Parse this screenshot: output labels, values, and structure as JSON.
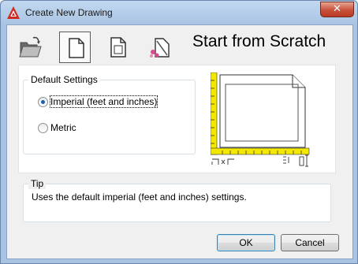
{
  "window": {
    "title": "Create New Drawing",
    "close_glyph": "✕"
  },
  "toolbar": {
    "items": [
      {
        "name": "open-drawing",
        "icon": "folder-open-icon",
        "selected": false
      },
      {
        "name": "start-from-scratch",
        "icon": "blank-page-icon",
        "selected": true
      },
      {
        "name": "use-template",
        "icon": "template-page-icon",
        "selected": false
      },
      {
        "name": "use-wizard",
        "icon": "wizard-icon",
        "selected": false
      }
    ]
  },
  "heading": "Start from Scratch",
  "default_settings": {
    "legend": "Default Settings",
    "options": [
      {
        "label": "Imperial (feet and inches)",
        "selected": true
      },
      {
        "label": "Metric",
        "selected": false
      }
    ]
  },
  "tip": {
    "legend": "Tip",
    "text": "Uses the default imperial (feet and inches) settings."
  },
  "buttons": {
    "ok": "OK",
    "cancel": "Cancel"
  },
  "colors": {
    "accent": "#1f5fa8",
    "ruler": "#f5e800",
    "close": "#c7503a"
  }
}
